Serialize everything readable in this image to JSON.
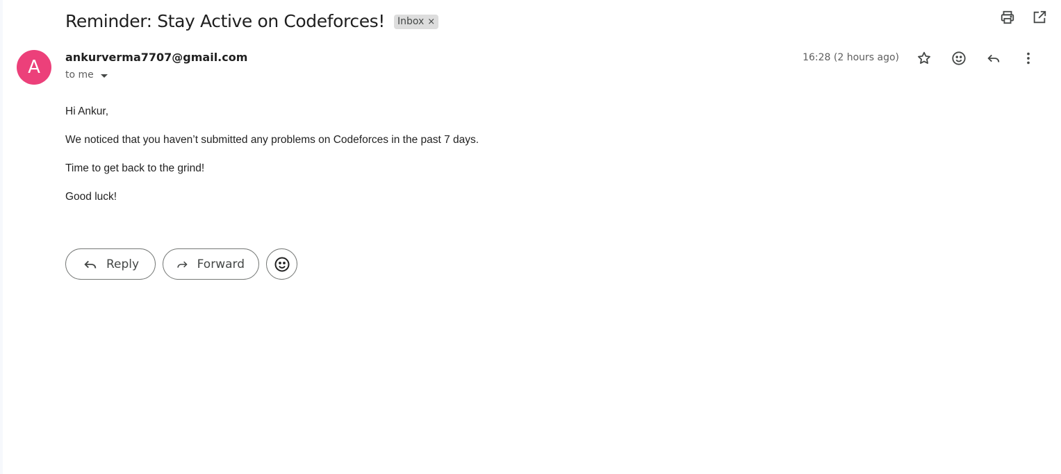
{
  "subject": "Reminder: Stay Active on Codeforces!",
  "label_chip": {
    "text": "Inbox",
    "remove": "×"
  },
  "sender": {
    "avatar_letter": "A",
    "avatar_color": "#ec407a",
    "email": "ankurverma7707@gmail.com",
    "recipient": "to me"
  },
  "timestamp": "16:28 (2 hours ago)",
  "body": [
    "Hi Ankur,",
    "We noticed that you haven’t submitted any problems on Codeforces in the past 7 days.",
    "Time to get back to the grind!",
    "Good luck!"
  ],
  "actions": {
    "reply": "Reply",
    "forward": "Forward"
  },
  "icons": {
    "top": [
      "print-icon",
      "open-in-new-window-icon"
    ],
    "message": [
      "star-icon",
      "emoji-reaction-icon",
      "reply-icon",
      "more-options-icon"
    ]
  },
  "colors": {
    "text": "#1f1f1f",
    "muted": "#5e5e5e",
    "icon": "#444746",
    "chip_bg": "#dddddd"
  }
}
